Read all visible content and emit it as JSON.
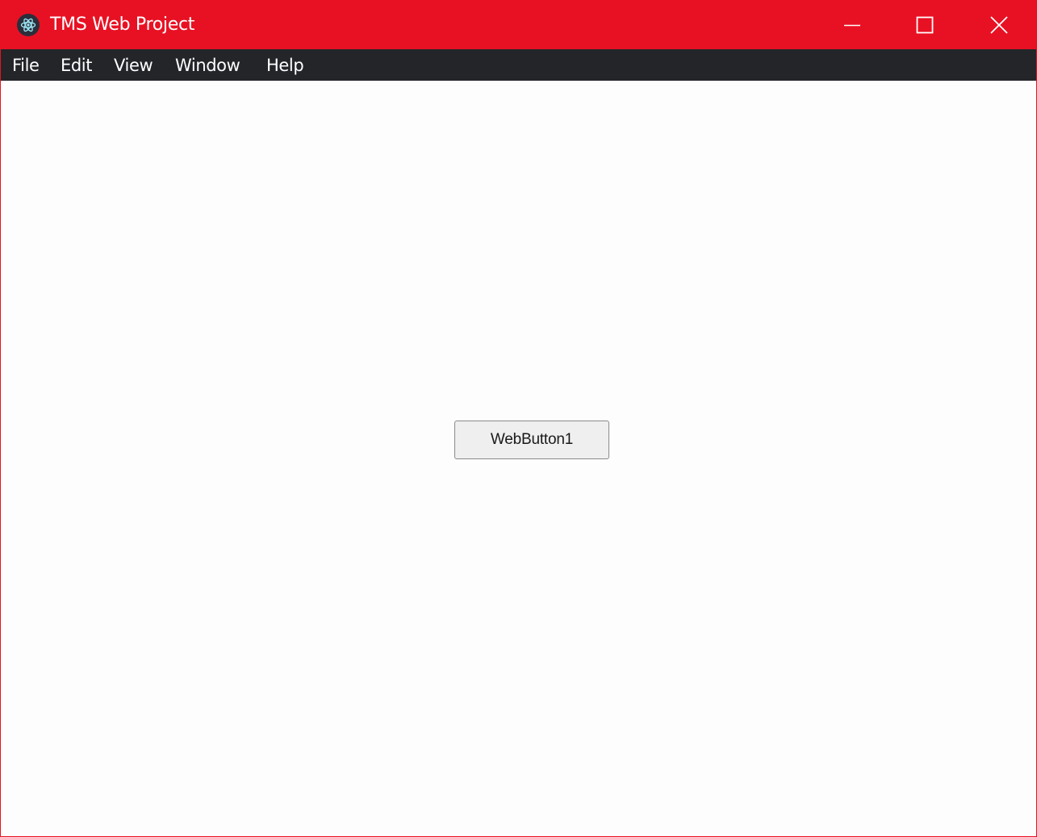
{
  "window": {
    "title": "TMS Web Project",
    "accent_color": "#e81123",
    "menubar_color": "#232529",
    "controls": {
      "minimize_icon": "minimize-icon",
      "maximize_icon": "maximize-icon",
      "close_icon": "close-icon"
    }
  },
  "menubar": {
    "items": [
      {
        "label": "File"
      },
      {
        "label": "Edit"
      },
      {
        "label": "View"
      },
      {
        "label": "Window"
      },
      {
        "label": "Help"
      }
    ]
  },
  "main": {
    "button_label": "WebButton1"
  }
}
